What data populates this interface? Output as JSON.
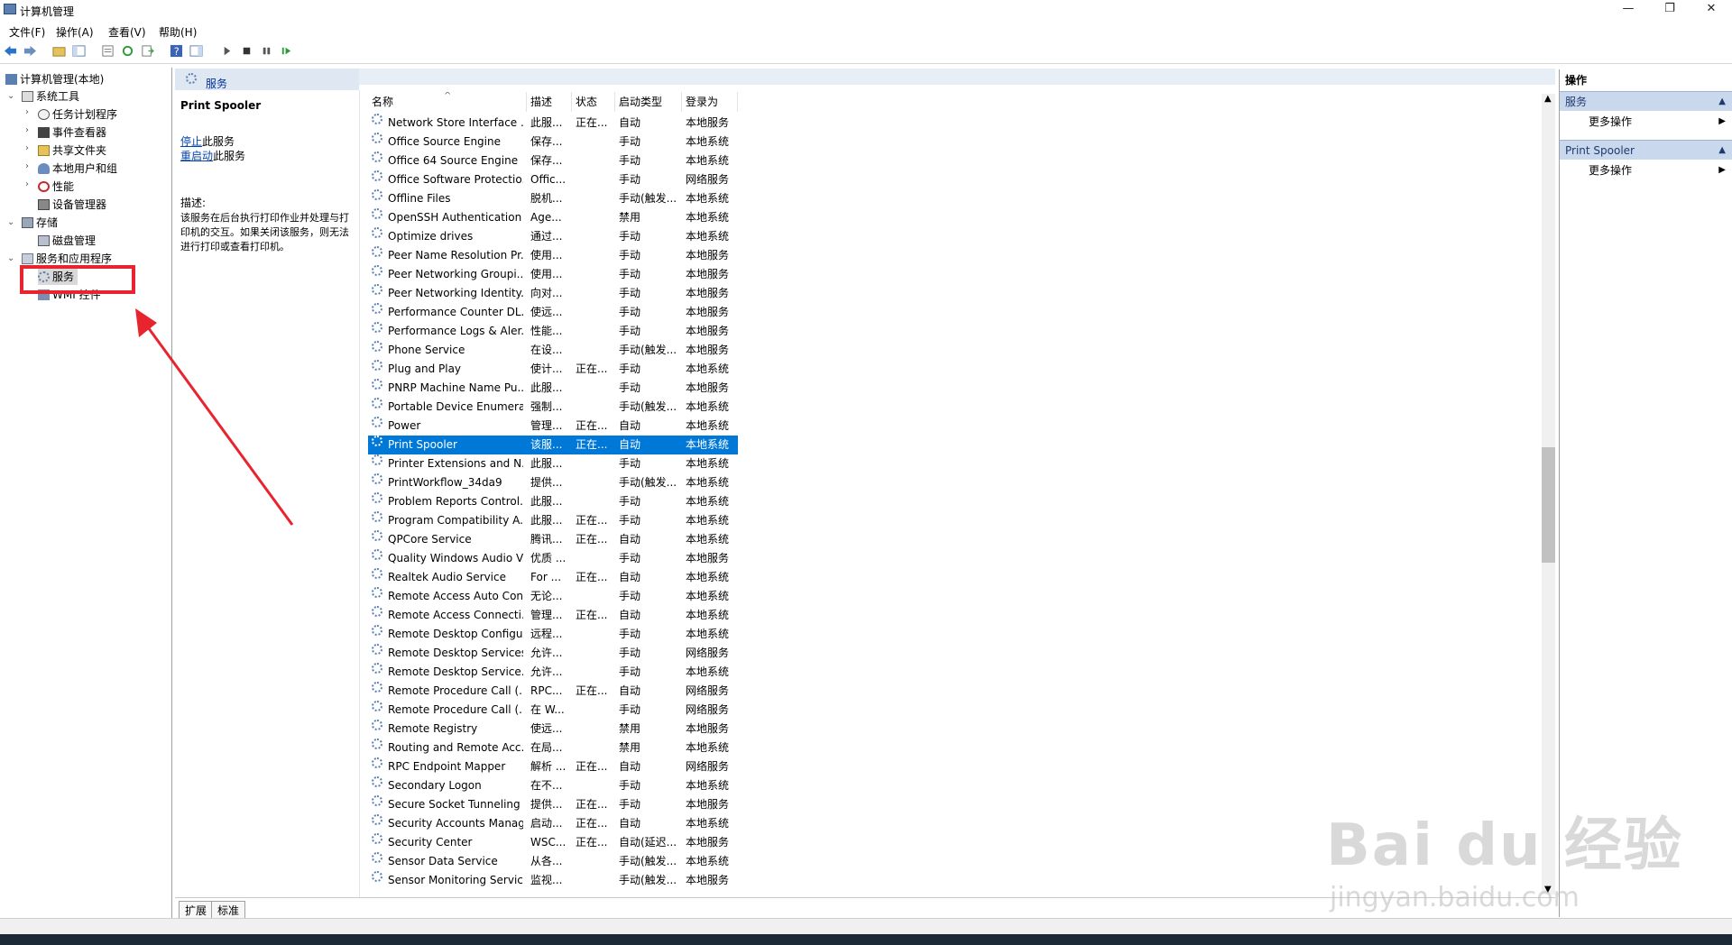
{
  "window": {
    "title": "计算机管理"
  },
  "menu": [
    "文件(F)",
    "操作(A)",
    "查看(V)",
    "帮助(H)"
  ],
  "tree": [
    {
      "label": "计算机管理(本地)",
      "level": 0,
      "expander": ""
    },
    {
      "label": "系统工具",
      "level": 1,
      "expander": "v"
    },
    {
      "label": "任务计划程序",
      "level": 2,
      "expander": ">"
    },
    {
      "label": "事件查看器",
      "level": 2,
      "expander": ">"
    },
    {
      "label": "共享文件夹",
      "level": 2,
      "expander": ">"
    },
    {
      "label": "本地用户和组",
      "level": 2,
      "expander": ">"
    },
    {
      "label": "性能",
      "level": 2,
      "expander": ">"
    },
    {
      "label": "设备管理器",
      "level": 2,
      "expander": ""
    },
    {
      "label": "存储",
      "level": 1,
      "expander": "v"
    },
    {
      "label": "磁盘管理",
      "level": 2,
      "expander": ""
    },
    {
      "label": "服务和应用程序",
      "level": 1,
      "expander": "v"
    },
    {
      "label": "服务",
      "level": 2,
      "expander": "",
      "selected": true
    },
    {
      "label": "WMI 控件",
      "level": 2,
      "expander": ""
    }
  ],
  "center": {
    "tab_title": "服务"
  },
  "detail": {
    "service_name": "Print Spooler",
    "stop_link": "停止",
    "stop_suffix": "此服务",
    "restart_link": "重启动",
    "restart_suffix": "此服务",
    "desc_label": "描述:",
    "desc_text": "该服务在后台执行打印作业并处理与打印机的交互。如果关闭该服务，则无法进行打印或查看打印机。"
  },
  "columns": [
    "名称",
    "描述",
    "状态",
    "启动类型",
    "登录为"
  ],
  "services": [
    [
      "Network Store Interface ...",
      "此服...",
      "正在...",
      "自动",
      "本地服务"
    ],
    [
      "Office  Source Engine",
      "保存...",
      "",
      "手动",
      "本地系统"
    ],
    [
      "Office 64 Source Engine",
      "保存...",
      "",
      "手动",
      "本地系统"
    ],
    [
      "Office Software Protectio...",
      "Offic...",
      "",
      "手动",
      "网络服务"
    ],
    [
      "Offline Files",
      "脱机...",
      "",
      "手动(触发...",
      "本地系统"
    ],
    [
      "OpenSSH Authentication ...",
      "Age...",
      "",
      "禁用",
      "本地系统"
    ],
    [
      "Optimize drives",
      "通过...",
      "",
      "手动",
      "本地系统"
    ],
    [
      "Peer Name Resolution Pr...",
      "使用...",
      "",
      "手动",
      "本地服务"
    ],
    [
      "Peer Networking Groupi...",
      "使用...",
      "",
      "手动",
      "本地服务"
    ],
    [
      "Peer Networking Identity...",
      "向对...",
      "",
      "手动",
      "本地服务"
    ],
    [
      "Performance Counter DL...",
      "使远...",
      "",
      "手动",
      "本地服务"
    ],
    [
      "Performance Logs & Aler...",
      "性能...",
      "",
      "手动",
      "本地服务"
    ],
    [
      "Phone Service",
      "在设...",
      "",
      "手动(触发...",
      "本地服务"
    ],
    [
      "Plug and Play",
      "使计...",
      "正在...",
      "手动",
      "本地系统"
    ],
    [
      "PNRP Machine Name Pu...",
      "此服...",
      "",
      "手动",
      "本地服务"
    ],
    [
      "Portable Device Enumera...",
      "强制...",
      "",
      "手动(触发...",
      "本地系统"
    ],
    [
      "Power",
      "管理...",
      "正在...",
      "自动",
      "本地系统"
    ],
    [
      "Print Spooler",
      "该服...",
      "正在...",
      "自动",
      "本地系统"
    ],
    [
      "Printer Extensions and N...",
      "此服...",
      "",
      "手动",
      "本地系统"
    ],
    [
      "PrintWorkflow_34da9",
      "提供...",
      "",
      "手动(触发...",
      "本地系统"
    ],
    [
      "Problem Reports Control...",
      "此服...",
      "",
      "手动",
      "本地系统"
    ],
    [
      "Program Compatibility A...",
      "此服...",
      "正在...",
      "手动",
      "本地系统"
    ],
    [
      "QPCore Service",
      "腾讯...",
      "正在...",
      "自动",
      "本地系统"
    ],
    [
      "Quality Windows Audio V...",
      "优质 ...",
      "",
      "手动",
      "本地服务"
    ],
    [
      "Realtek Audio Service",
      "For ...",
      "正在...",
      "自动",
      "本地系统"
    ],
    [
      "Remote Access Auto Con...",
      "无论...",
      "",
      "手动",
      "本地系统"
    ],
    [
      "Remote Access Connecti...",
      "管理...",
      "正在...",
      "自动",
      "本地系统"
    ],
    [
      "Remote Desktop Configu...",
      "远程...",
      "",
      "手动",
      "本地系统"
    ],
    [
      "Remote Desktop Services",
      "允许...",
      "",
      "手动",
      "网络服务"
    ],
    [
      "Remote Desktop Service...",
      "允许...",
      "",
      "手动",
      "本地系统"
    ],
    [
      "Remote Procedure Call (...",
      "RPC...",
      "正在...",
      "自动",
      "网络服务"
    ],
    [
      "Remote Procedure Call (...",
      "在 W...",
      "",
      "手动",
      "网络服务"
    ],
    [
      "Remote Registry",
      "使远...",
      "",
      "禁用",
      "本地服务"
    ],
    [
      "Routing and Remote Acc...",
      "在局...",
      "",
      "禁用",
      "本地系统"
    ],
    [
      "RPC Endpoint Mapper",
      "解析 ...",
      "正在...",
      "自动",
      "网络服务"
    ],
    [
      "Secondary Logon",
      "在不...",
      "",
      "手动",
      "本地系统"
    ],
    [
      "Secure Socket Tunneling ...",
      "提供...",
      "正在...",
      "手动",
      "本地服务"
    ],
    [
      "Security Accounts Manag...",
      "启动...",
      "正在...",
      "自动",
      "本地系统"
    ],
    [
      "Security Center",
      "WSC...",
      "正在...",
      "自动(延迟...",
      "本地服务"
    ],
    [
      "Sensor Data Service",
      "从各...",
      "",
      "手动(触发...",
      "本地系统"
    ],
    [
      "Sensor Monitoring Service",
      "监视...",
      "",
      "手动(触发...",
      "本地服务"
    ]
  ],
  "selected_index": 17,
  "bottom_tabs": [
    "扩展",
    "标准"
  ],
  "actions": {
    "header": "操作",
    "sections": [
      {
        "title": "服务",
        "item": "更多操作"
      },
      {
        "title": "Print Spooler",
        "item": "更多操作"
      }
    ]
  },
  "watermark": {
    "logo": "Bai du 经验",
    "url": "jingyan.baidu.com"
  },
  "colors": {
    "selection": "#0078d7",
    "annotation": "#e8252f",
    "section_header": "#cad8ee"
  }
}
